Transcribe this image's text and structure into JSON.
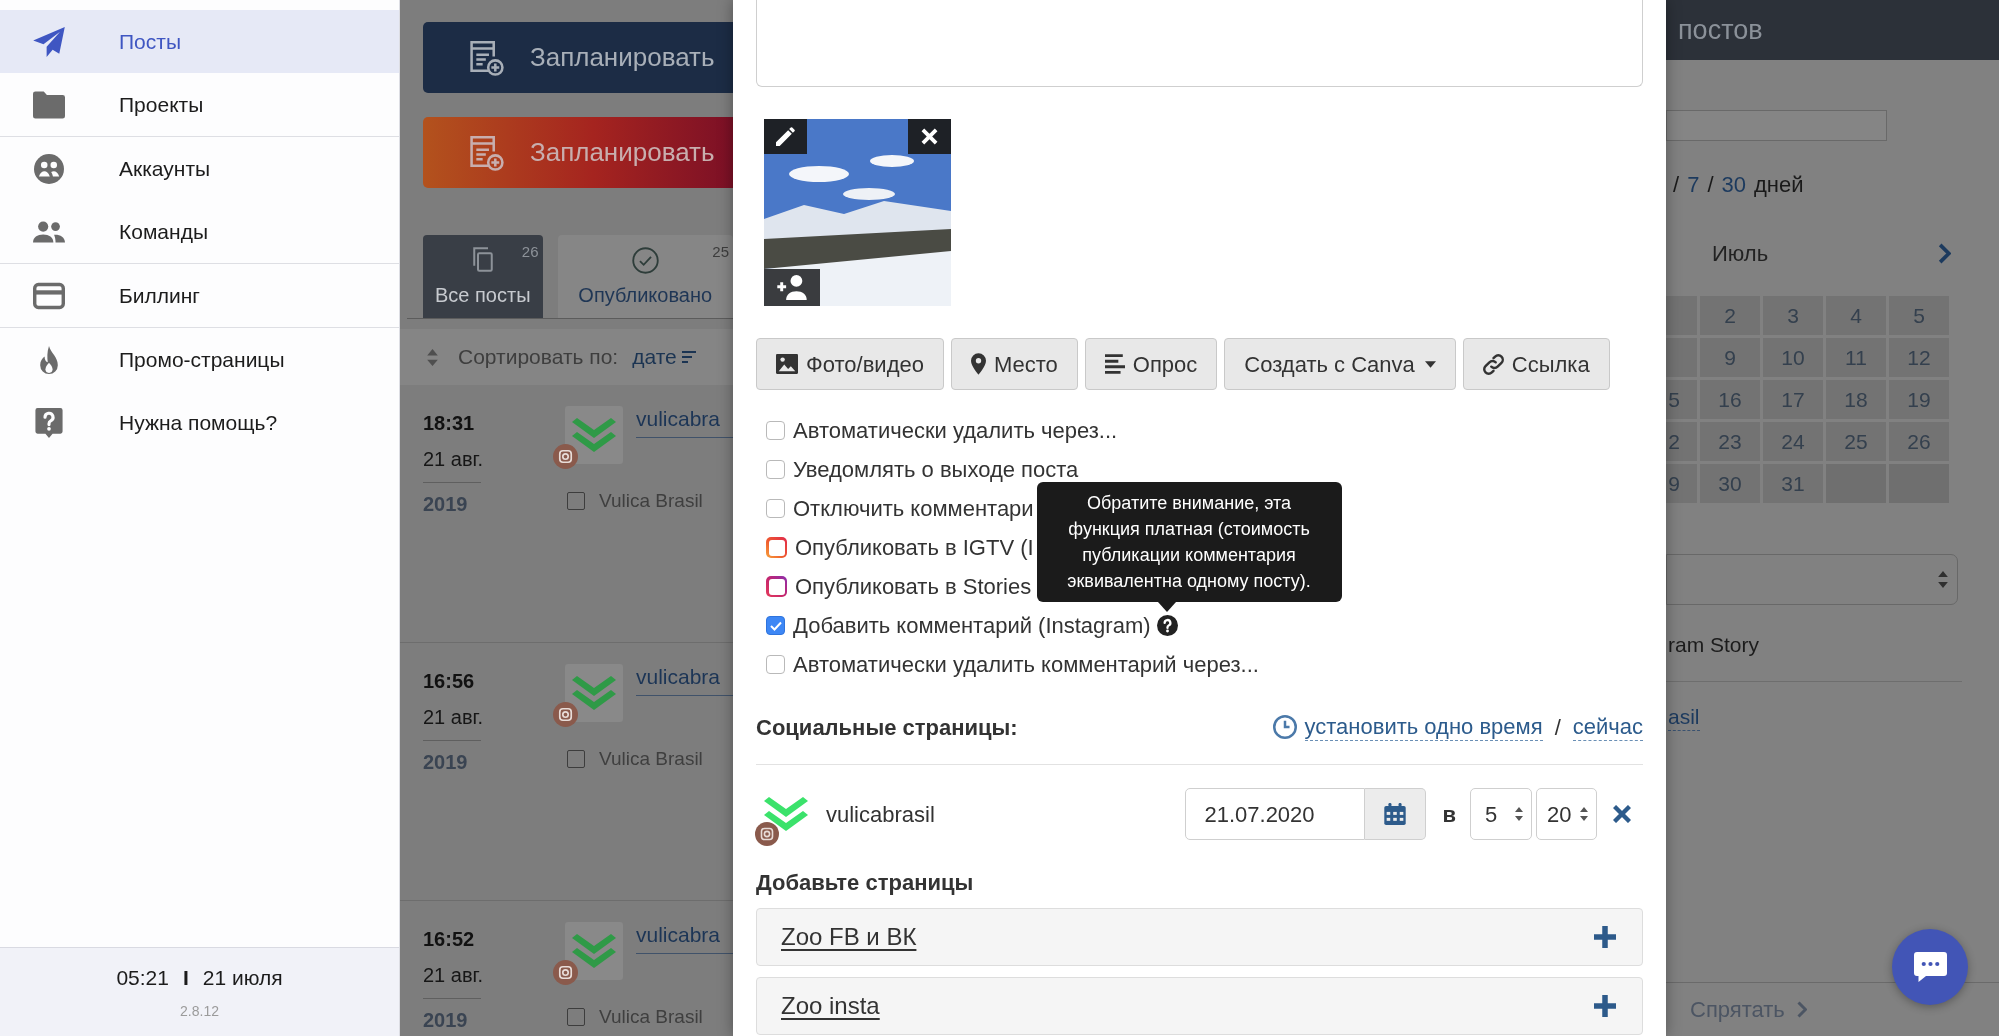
{
  "sidebar": {
    "groups": [
      {
        "items": [
          {
            "label": "Посты",
            "selected": true
          },
          {
            "label": "Проекты",
            "selected": false
          }
        ]
      },
      {
        "items": [
          {
            "label": "Аккаунты",
            "selected": false
          },
          {
            "label": "Команды",
            "selected": false
          }
        ]
      },
      {
        "items": [
          {
            "label": "Биллинг",
            "selected": false
          }
        ]
      },
      {
        "items": [
          {
            "label": "Промо-страницы",
            "selected": false
          },
          {
            "label": "Нужна помощь?",
            "selected": false
          }
        ]
      }
    ],
    "footer": {
      "time": "05:21",
      "separator": "I",
      "date": "21 июля",
      "version": "2.8.12"
    }
  },
  "posts_page": {
    "schedule_buttons": [
      {
        "label": "Запланировать",
        "kind": "standard"
      },
      {
        "label": "Запланировать",
        "kind": "instagram"
      }
    ],
    "tabs": [
      {
        "label": "Все посты",
        "count": "26",
        "selected": true
      },
      {
        "label": "Опубликовано",
        "count": "25",
        "selected": false
      }
    ],
    "sort": {
      "label": "Сортировать по:",
      "value": "дате"
    },
    "posts": [
      {
        "time": "18:31",
        "date": "21 авг.",
        "year": "2019",
        "account": "vulicabra",
        "page": "Vulica Brasil",
        "checked": false
      },
      {
        "time": "16:56",
        "date": "21 авг.",
        "year": "2019",
        "account": "vulicabra",
        "page": "Vulica Brasil",
        "checked": false
      },
      {
        "time": "16:52",
        "date": "21 авг.",
        "year": "2019",
        "account": "vulicabra",
        "page": "Vulica Brasil",
        "checked": false
      }
    ]
  },
  "modal": {
    "attach_buttons": [
      {
        "label": "Фото/видео",
        "kind": "plain"
      },
      {
        "label": "Место",
        "kind": "plain"
      },
      {
        "label": "Опрос",
        "kind": "plain"
      },
      {
        "label": "Создать с Canva",
        "kind": "dropdown"
      },
      {
        "label": "Ссылка",
        "kind": "plain"
      }
    ],
    "options": [
      {
        "label": "Автоматически удалить через...",
        "kind": "plain",
        "checked": false
      },
      {
        "label": "Уведомлять о выходе поста",
        "kind": "plain",
        "checked": false
      },
      {
        "label": "Отключить комментари",
        "kind": "plain",
        "checked": false
      },
      {
        "label": "Опубликовать в IGTV (I",
        "kind": "igtv",
        "checked": false
      },
      {
        "label": "Опубликовать в Stories",
        "kind": "stories",
        "checked": false
      },
      {
        "label": "Добавить комментарий (Instagram)",
        "kind": "plain",
        "checked": true,
        "help": true
      },
      {
        "label": "Автоматически удалить комментарий через...",
        "kind": "plain",
        "checked": false
      }
    ],
    "tooltip": {
      "lines": [
        "Обратите внимание, эта",
        "функция платная (стоимость",
        "публикации комментария",
        "эквивалентна одному посту)."
      ]
    },
    "social": {
      "title": "Социальные страницы:",
      "set_time": "установить одно время",
      "separator": "/",
      "now": "сейчас"
    },
    "accounts": [
      {
        "name": "vulicabrasil",
        "date": "21.07.2020",
        "at": "в",
        "hour": "5",
        "minute": "20"
      }
    ],
    "add_pages": {
      "title": "Добавьте страницы",
      "pages": [
        "Zoo FB и ВК",
        "Zoo insta"
      ]
    }
  },
  "calendar_panel": {
    "title": "постов",
    "period": [
      {
        "text": "/",
        "kind": "separator"
      },
      {
        "text": "7",
        "kind": "link"
      },
      {
        "text": "/",
        "kind": "separator"
      },
      {
        "text": "30",
        "kind": "link"
      },
      {
        "text": "дней",
        "kind": "text"
      }
    ],
    "calendar": {
      "month": "Июль",
      "weeks": [
        {
          "days": [
            "2",
            "3",
            "4",
            "5"
          ]
        },
        {
          "days": [
            "9",
            "10",
            "11",
            "12"
          ]
        },
        {
          "cut_day": "5",
          "days": [
            "16",
            "17",
            "18",
            "19"
          ]
        },
        {
          "cut_day": "2",
          "days": [
            "23",
            "24",
            "25",
            "26"
          ]
        },
        {
          "cut_day": "9",
          "days": [
            "30",
            "31"
          ]
        }
      ]
    },
    "story_label": "ram Story",
    "account_link": "asil",
    "hide_button": "Спрятать"
  }
}
